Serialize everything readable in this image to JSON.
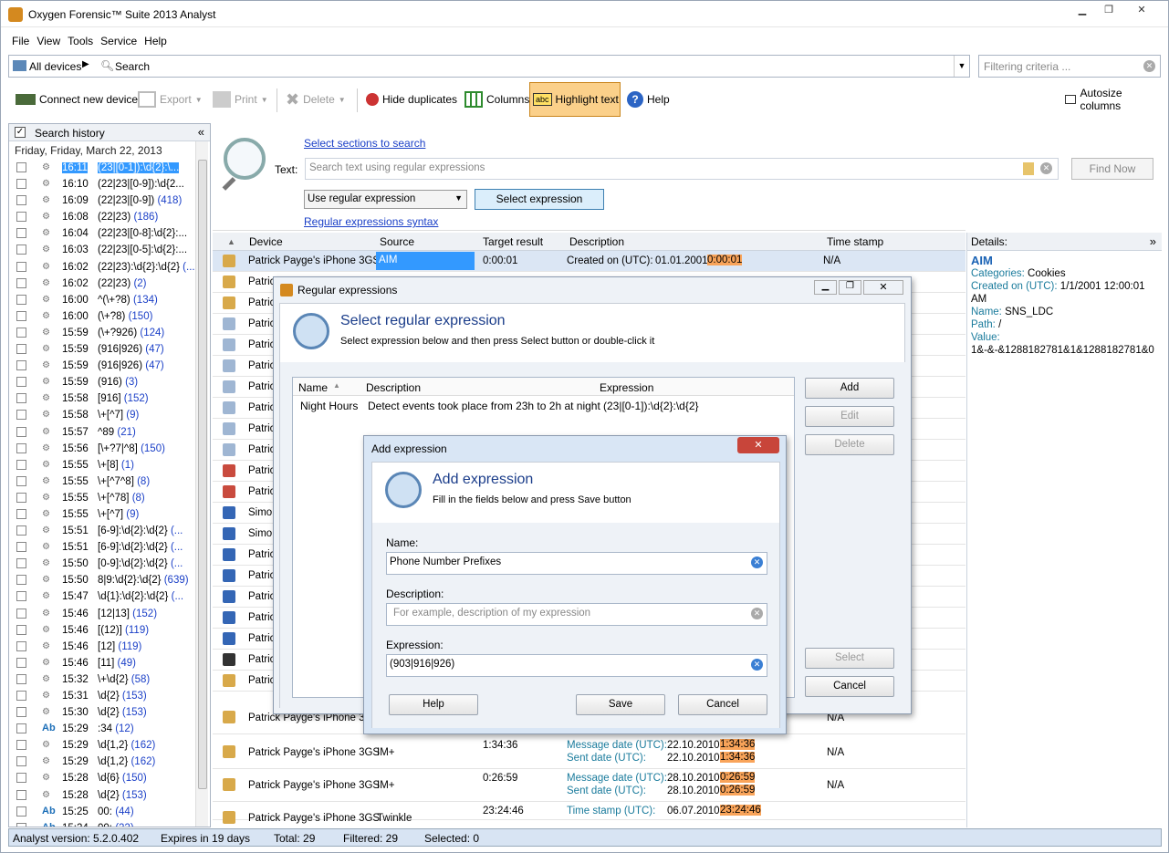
{
  "app": {
    "title": "Oxygen Forensic™ Suite 2013 Analyst"
  },
  "menu": [
    "File",
    "View",
    "Tools",
    "Service",
    "Help"
  ],
  "address": {
    "device": "All devices",
    "search": "Search",
    "filter_placeholder": "Filtering criteria ..."
  },
  "toolbar": {
    "connect": "Connect new device",
    "export": "Export",
    "print": "Print",
    "delete": "Delete",
    "hide_duplicates": "Hide duplicates",
    "columns": "Columns",
    "highlight": "Highlight text",
    "help": "Help",
    "autosize": "Autosize columns"
  },
  "history": {
    "title": "Search history",
    "date": "Friday, Friday, March 22, 2013",
    "rows": [
      {
        "t": "16:11",
        "e": "(23|[0-1]):\\d{2}:\\...",
        "c": "",
        "ab": false,
        "sel": true
      },
      {
        "t": "16:10",
        "e": "(22|23|[0-9]):\\d{2...",
        "c": "",
        "ab": false
      },
      {
        "t": "16:09",
        "e": "(22|23|[0-9])",
        "c": "(418)",
        "ab": false
      },
      {
        "t": "16:08",
        "e": "(22|23)",
        "c": "(186)",
        "ab": false
      },
      {
        "t": "16:04",
        "e": "(22|23|[0-8]:\\d{2}:...",
        "c": "",
        "ab": false
      },
      {
        "t": "16:03",
        "e": "(22|23|[0-5]:\\d{2}:...",
        "c": "",
        "ab": false
      },
      {
        "t": "16:02",
        "e": "(22|23):\\d{2}:\\d{2}",
        "c": "(...",
        "ab": false
      },
      {
        "t": "16:02",
        "e": "(22|23)",
        "c": "(2)",
        "ab": false
      },
      {
        "t": "16:00",
        "e": "^(\\+?8)",
        "c": "(134)",
        "ab": false
      },
      {
        "t": "16:00",
        "e": "(\\+?8)",
        "c": "(150)",
        "ab": false
      },
      {
        "t": "15:59",
        "e": "(\\+?926)",
        "c": "(124)",
        "ab": false
      },
      {
        "t": "15:59",
        "e": "(916|926)",
        "c": "(47)",
        "ab": false
      },
      {
        "t": "15:59",
        "e": "(916|926)",
        "c": "(47)",
        "ab": false
      },
      {
        "t": "15:59",
        "e": "(916)",
        "c": "(3)",
        "ab": false
      },
      {
        "t": "15:58",
        "e": "[916]",
        "c": "(152)",
        "ab": false
      },
      {
        "t": "15:58",
        "e": "\\+[^7]",
        "c": "(9)",
        "ab": false
      },
      {
        "t": "15:57",
        "e": "^89",
        "c": "(21)",
        "ab": false
      },
      {
        "t": "15:56",
        "e": "[\\+?7|^8]",
        "c": "(150)",
        "ab": false
      },
      {
        "t": "15:55",
        "e": "\\+[8]",
        "c": "(1)",
        "ab": false
      },
      {
        "t": "15:55",
        "e": "\\+[^7^8]",
        "c": "(8)",
        "ab": false
      },
      {
        "t": "15:55",
        "e": "\\+[^78]",
        "c": "(8)",
        "ab": false
      },
      {
        "t": "15:55",
        "e": "\\+[^7]",
        "c": "(9)",
        "ab": false
      },
      {
        "t": "15:51",
        "e": "[6-9]:\\d{2}:\\d{2}",
        "c": "(...",
        "ab": false
      },
      {
        "t": "15:51",
        "e": "[6-9]:\\d{2}:\\d{2}",
        "c": "(...",
        "ab": false
      },
      {
        "t": "15:50",
        "e": "[0-9]:\\d{2}:\\d{2}",
        "c": "(...",
        "ab": false
      },
      {
        "t": "15:50",
        "e": "8|9:\\d{2}:\\d{2}",
        "c": "(639)",
        "ab": false
      },
      {
        "t": "15:47",
        "e": "\\d{1}:\\d{2}:\\d{2}",
        "c": "(...",
        "ab": false
      },
      {
        "t": "15:46",
        "e": "[12|13]",
        "c": "(152)",
        "ab": false
      },
      {
        "t": "15:46",
        "e": "[(12)]",
        "c": "(119)",
        "ab": false
      },
      {
        "t": "15:46",
        "e": "[12]",
        "c": "(119)",
        "ab": false
      },
      {
        "t": "15:46",
        "e": "[11]",
        "c": "(49)",
        "ab": false
      },
      {
        "t": "15:32",
        "e": "\\+\\d{2}",
        "c": "(58)",
        "ab": false
      },
      {
        "t": "15:31",
        "e": "\\d{2}",
        "c": "(153)",
        "ab": false
      },
      {
        "t": "15:30",
        "e": "\\d{2}",
        "c": "(153)",
        "ab": false
      },
      {
        "t": "15:29",
        "e": ":34",
        "c": "(12)",
        "ab": true
      },
      {
        "t": "15:29",
        "e": "\\d{1,2}",
        "c": "(162)",
        "ab": false
      },
      {
        "t": "15:29",
        "e": "\\d{1,2}",
        "c": "(162)",
        "ab": false
      },
      {
        "t": "15:28",
        "e": "\\d{6}",
        "c": "(150)",
        "ab": false
      },
      {
        "t": "15:28",
        "e": "\\d{2}",
        "c": "(153)",
        "ab": false
      },
      {
        "t": "15:25",
        "e": "00:",
        "c": "(44)",
        "ab": true
      },
      {
        "t": "15:24",
        "e": "00:",
        "c": "(22)",
        "ab": true
      }
    ]
  },
  "search": {
    "select_sections": "Select sections to search",
    "text_label": "Text:",
    "placeholder": "Search text using regular expressions",
    "find_now": "Find Now",
    "mode": "Use regular expression",
    "select_expression": "Select expression",
    "syntax": "Regular expressions syntax"
  },
  "grid": {
    "headers": [
      "Device",
      "Source",
      "Target result",
      "Description",
      "Time stamp"
    ],
    "row1": {
      "device": "Patrick Payge's iPhone 3GS",
      "source": "AIM",
      "target": "0:00:01",
      "desc": "Created on (UTC):",
      "date": "01.01.2001",
      "hl": "0:00:01",
      "ts": "N/A"
    },
    "truncated": [
      "Patric",
      "Patric",
      "Patric",
      "Patric",
      "Patric",
      "Patric",
      "Patric",
      "Patric",
      "Patric",
      "Patric",
      "Patric",
      "Simon",
      "Simon",
      "Patric",
      "Patric",
      "Patric",
      "Patric",
      "Patric",
      "Patric",
      "Patric"
    ],
    "lower": [
      {
        "device": "Patrick Payge's iPhone 3GS",
        "source": "",
        "target": "",
        "ts": "N/A"
      },
      {
        "device": "Patrick Payge's iPhone 3GS",
        "source": "IM+",
        "target": "1:34:36",
        "l1": "Message date (UTC):",
        "d1": "22.10.2010",
        "h1": "1:34:36",
        "l2": "Sent date (UTC):",
        "d2": "22.10.2010",
        "h2": "1:34:36",
        "ts": "N/A"
      },
      {
        "device": "Patrick Payge's iPhone 3GS",
        "source": "IM+",
        "target": "0:26:59",
        "l1": "Message date (UTC):",
        "d1": "28.10.2010",
        "h1": "0:26:59",
        "l2": "Sent date (UTC):",
        "d2": "28.10.2010",
        "h2": "0:26:59",
        "ts": "N/A"
      },
      {
        "device": "Patrick Payge's iPhone 3GS",
        "source": "Twinkle",
        "target": "23:24:46",
        "l1": "Time stamp (UTC):",
        "d1": "06.07.2010",
        "h1": "23:24:46",
        "ts": ""
      }
    ]
  },
  "details": {
    "title": "Details:",
    "name": "AIM",
    "categories_k": "Categories:",
    "categories_v": "Cookies",
    "created_k": "Created on (UTC):",
    "created_v": "1/1/2001 12:00:01 AM",
    "name_k": "Name:",
    "name_v": "SNS_LDC",
    "path_k": "Path:",
    "path_v": "/",
    "value_k": "Value:",
    "value_v": "1&-&-&1288182781&1&1288182781&0"
  },
  "status": {
    "version": "Analyst version: 5.2.0.402",
    "expires": "Expires in 19 days",
    "total": "Total: 29",
    "filtered": "Filtered: 29",
    "selected": "Selected: 0"
  },
  "regex_dialog": {
    "title": "Regular expressions",
    "heading": "Select regular expression",
    "subtitle": "Select expression below and then press Select button or double-click it",
    "cols": [
      "Name",
      "Description",
      "Expression"
    ],
    "row": {
      "name": "Night Hours",
      "desc": "Detect events took place from 23h to 2h at night",
      "expr": "(23|[0-1]):\\d{2}:\\d{2}"
    },
    "add": "Add",
    "edit": "Edit",
    "delete": "Delete",
    "select": "Select",
    "cancel": "Cancel"
  },
  "add_dialog": {
    "title": "Add expression",
    "heading": "Add expression",
    "subtitle": "Fill in the fields below and press Save button",
    "name_label": "Name:",
    "name_value": "Phone Number Prefixes",
    "desc_label": "Description:",
    "desc_placeholder": "For example, description of my expression",
    "expr_label": "Expression:",
    "expr_value": "(903|916|926)",
    "help": "Help",
    "save": "Save",
    "cancel": "Cancel"
  },
  "colors": {
    "accent": "#1a3fc7",
    "highlight": "#f9a45a",
    "selection": "#3399ff"
  }
}
